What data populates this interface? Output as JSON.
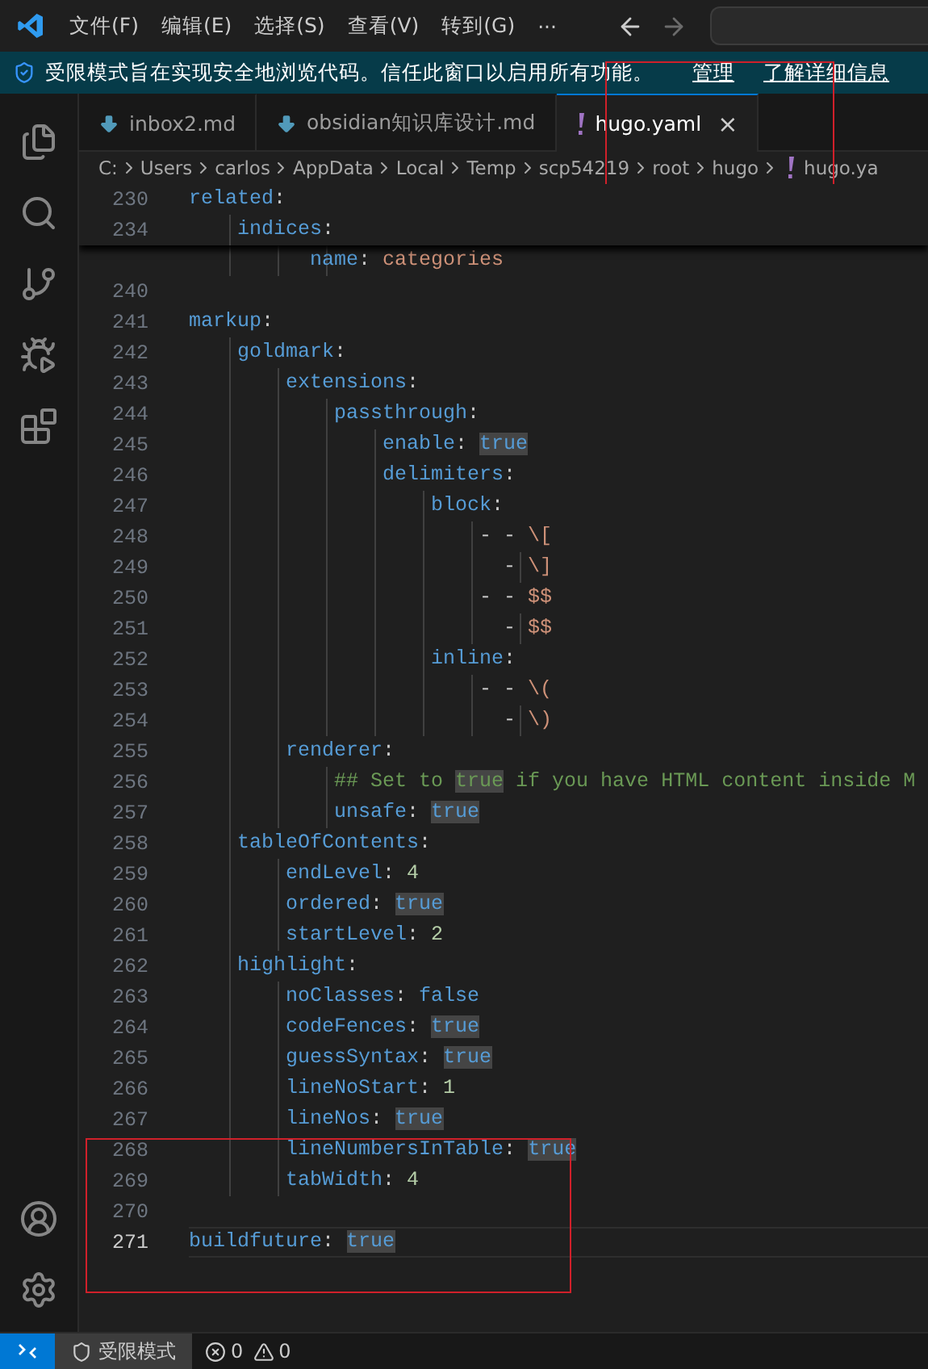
{
  "title_bar": {
    "menus": [
      "文件(F)",
      "编辑(E)",
      "选择(S)",
      "查看(V)",
      "转到(G)",
      "···"
    ]
  },
  "banner": {
    "text": "受限模式旨在实现安全地浏览代码。信任此窗口以启用所有功能。",
    "links": [
      "管理",
      "了解详细信息"
    ]
  },
  "tabs": [
    {
      "label": "inbox2.md",
      "kind": "markdown",
      "selected": false
    },
    {
      "label": "obsidian知识库设计.md",
      "kind": "markdown",
      "selected": false
    },
    {
      "label": "hugo.yaml",
      "kind": "yaml",
      "selected": true,
      "close": "×"
    }
  ],
  "breadcrumb": [
    {
      "label": "C:",
      "kind": "folder"
    },
    {
      "label": "Users",
      "kind": "folder"
    },
    {
      "label": "carlos",
      "kind": "folder"
    },
    {
      "label": "AppData",
      "kind": "folder"
    },
    {
      "label": "Local",
      "kind": "folder"
    },
    {
      "label": "Temp",
      "kind": "folder"
    },
    {
      "label": "scp54219",
      "kind": "folder"
    },
    {
      "label": "root",
      "kind": "folder"
    },
    {
      "label": "hugo",
      "kind": "folder"
    },
    {
      "label": "hugo.ya",
      "kind": "yaml"
    }
  ],
  "sticky_lines": [
    {
      "num": "230",
      "current": false,
      "kind": "section",
      "text": "related:"
    },
    {
      "num": "234",
      "current": false,
      "kind": "section",
      "text": "    indices:"
    }
  ],
  "lines": [
    {
      "current": false,
      "kind": "string",
      "text": "          name: ",
      "value": "categories",
      "highlight": false
    },
    {
      "num": "240",
      "current": false,
      "kind": "blank"
    },
    {
      "num": "241",
      "current": false,
      "kind": "section",
      "text": "markup:"
    },
    {
      "num": "242",
      "current": false,
      "kind": "section",
      "text": "    goldmark:"
    },
    {
      "num": "243",
      "current": false,
      "kind": "section",
      "text": "        extensions:"
    },
    {
      "num": "244",
      "current": false,
      "kind": "section",
      "text": "            passthrough:"
    },
    {
      "num": "245",
      "current": false,
      "kind": "bool",
      "text": "                enable: ",
      "value": "true",
      "highlight": true
    },
    {
      "num": "246",
      "current": false,
      "kind": "section",
      "text": "                delimiters:"
    },
    {
      "num": "247",
      "current": false,
      "kind": "section",
      "text": "                    block:"
    },
    {
      "num": "248",
      "current": false,
      "kind": "list",
      "text": "                        - - ",
      "value": "\\[",
      "highlight": false
    },
    {
      "num": "249",
      "current": false,
      "kind": "list",
      "text": "                          - ",
      "value": "\\]",
      "highlight": false
    },
    {
      "num": "250",
      "current": false,
      "kind": "list",
      "text": "                        - - ",
      "value": "$$",
      "highlight": false
    },
    {
      "num": "251",
      "current": false,
      "kind": "list",
      "text": "                          - ",
      "value": "$$",
      "highlight": false
    },
    {
      "num": "252",
      "current": false,
      "kind": "section",
      "text": "                    inline:"
    },
    {
      "num": "253",
      "current": false,
      "kind": "list",
      "text": "                        - - ",
      "value": "\\(",
      "highlight": false
    },
    {
      "num": "254",
      "current": false,
      "kind": "list",
      "text": "                          - ",
      "value": "\\)",
      "highlight": false
    },
    {
      "num": "255",
      "current": false,
      "kind": "section",
      "text": "        renderer:"
    },
    {
      "num": "256",
      "current": false,
      "kind": "comment",
      "text": "            ## Set to ",
      "value": "true",
      "rest": " if you have HTML content inside M",
      "highlight": true
    },
    {
      "num": "257",
      "current": false,
      "kind": "bool",
      "text": "            unsafe: ",
      "value": "true",
      "highlight": true
    },
    {
      "num": "258",
      "current": false,
      "kind": "section",
      "text": "    tableOfContents:"
    },
    {
      "num": "259",
      "current": false,
      "kind": "number",
      "text": "        endLevel: ",
      "value": "4",
      "highlight": false
    },
    {
      "num": "260",
      "current": false,
      "kind": "bool",
      "text": "        ordered: ",
      "value": "true",
      "highlight": true
    },
    {
      "num": "261",
      "current": false,
      "kind": "number",
      "text": "        startLevel: ",
      "value": "2",
      "highlight": false
    },
    {
      "num": "262",
      "current": false,
      "kind": "section",
      "text": "    highlight:"
    },
    {
      "num": "263",
      "current": false,
      "kind": "bool",
      "text": "        noClasses: ",
      "value": "false",
      "highlight": false
    },
    {
      "num": "264",
      "current": false,
      "kind": "bool",
      "text": "        codeFences: ",
      "value": "true",
      "highlight": true
    },
    {
      "num": "265",
      "current": false,
      "kind": "bool",
      "text": "        guessSyntax: ",
      "value": "true",
      "highlight": true
    },
    {
      "num": "266",
      "current": false,
      "kind": "number",
      "text": "        lineNoStart: ",
      "value": "1",
      "highlight": false
    },
    {
      "num": "267",
      "current": false,
      "kind": "bool",
      "text": "        lineNos: ",
      "value": "true",
      "highlight": true
    },
    {
      "num": "268",
      "current": false,
      "kind": "bool",
      "text": "        lineNumbersInTable: ",
      "value": "true",
      "highlight": true
    },
    {
      "num": "269",
      "current": false,
      "kind": "number",
      "text": "        tabWidth: ",
      "value": "4",
      "highlight": false
    },
    {
      "num": "270",
      "current": false,
      "kind": "blank"
    },
    {
      "num": "271",
      "current": true,
      "kind": "bool",
      "text": "buildfuture: ",
      "value": "true",
      "highlight": true
    }
  ],
  "status_bar": {
    "mode": "受限模式",
    "errors": "0",
    "warnings": "0"
  }
}
